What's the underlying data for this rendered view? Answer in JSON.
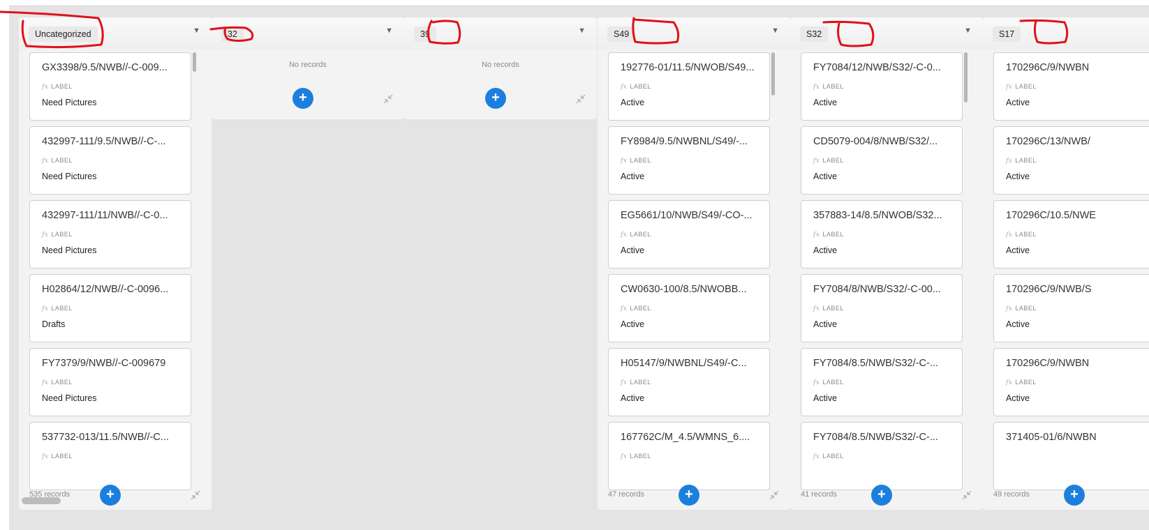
{
  "board": {
    "card_field_label": "LABEL",
    "empty_text": "No records",
    "add_label": "+",
    "columns": [
      {
        "title": "Uncategorized",
        "record_count": "535 records",
        "cards": [
          {
            "title": "GX3398/9.5/NWB//-C-009...",
            "value": "Need Pictures"
          },
          {
            "title": "432997-111/9.5/NWB//-C-...",
            "value": "Need Pictures"
          },
          {
            "title": "432997-111/11/NWB//-C-0...",
            "value": "Need Pictures"
          },
          {
            "title": "H02864/12/NWB//-C-0096...",
            "value": "Drafts"
          },
          {
            "title": "FY7379/9/NWB//-C-009679",
            "value": "Need Pictures"
          },
          {
            "title": "537732-013/11.5/NWB//-C...",
            "value": ""
          }
        ]
      },
      {
        "title": "32",
        "record_count": "",
        "cards": []
      },
      {
        "title": "39",
        "record_count": "",
        "cards": []
      },
      {
        "title": "S49",
        "record_count": "47 records",
        "cards": [
          {
            "title": "192776-01/11.5/NWOB/S49...",
            "value": "Active"
          },
          {
            "title": "FY8984/9.5/NWBNL/S49/-...",
            "value": "Active"
          },
          {
            "title": "EG5661/10/NWB/S49/-CO-...",
            "value": "Active"
          },
          {
            "title": "CW0630-100/8.5/NWOBB...",
            "value": "Active"
          },
          {
            "title": "H05147/9/NWBNL/S49/-C...",
            "value": "Active"
          },
          {
            "title": "167762C/M_4.5/WMNS_6....",
            "value": ""
          }
        ]
      },
      {
        "title": "S32",
        "record_count": "41 records",
        "cards": [
          {
            "title": "FY7084/12/NWB/S32/-C-0...",
            "value": "Active"
          },
          {
            "title": "CD5079-004/8/NWB/S32/...",
            "value": "Active"
          },
          {
            "title": "357883-14/8.5/NWOB/S32...",
            "value": "Active"
          },
          {
            "title": "FY7084/8/NWB/S32/-C-00...",
            "value": "Active"
          },
          {
            "title": "FY7084/8.5/NWB/S32/-C-...",
            "value": "Active"
          },
          {
            "title": "FY7084/8.5/NWB/S32/-C-...",
            "value": ""
          }
        ]
      },
      {
        "title": "S17",
        "record_count": "49 records",
        "cards": [
          {
            "title": "170296C/9/NWBN",
            "value": "Active"
          },
          {
            "title": "170296C/13/NWB/",
            "value": "Active"
          },
          {
            "title": "170296C/10.5/NWE",
            "value": "Active"
          },
          {
            "title": "170296C/9/NWB/S",
            "value": "Active"
          },
          {
            "title": "170296C/9/NWBN",
            "value": "Active"
          },
          {
            "title": "371405-01/6/NWBN",
            "value": ""
          }
        ]
      }
    ]
  },
  "annotation_color": "#e0101a"
}
